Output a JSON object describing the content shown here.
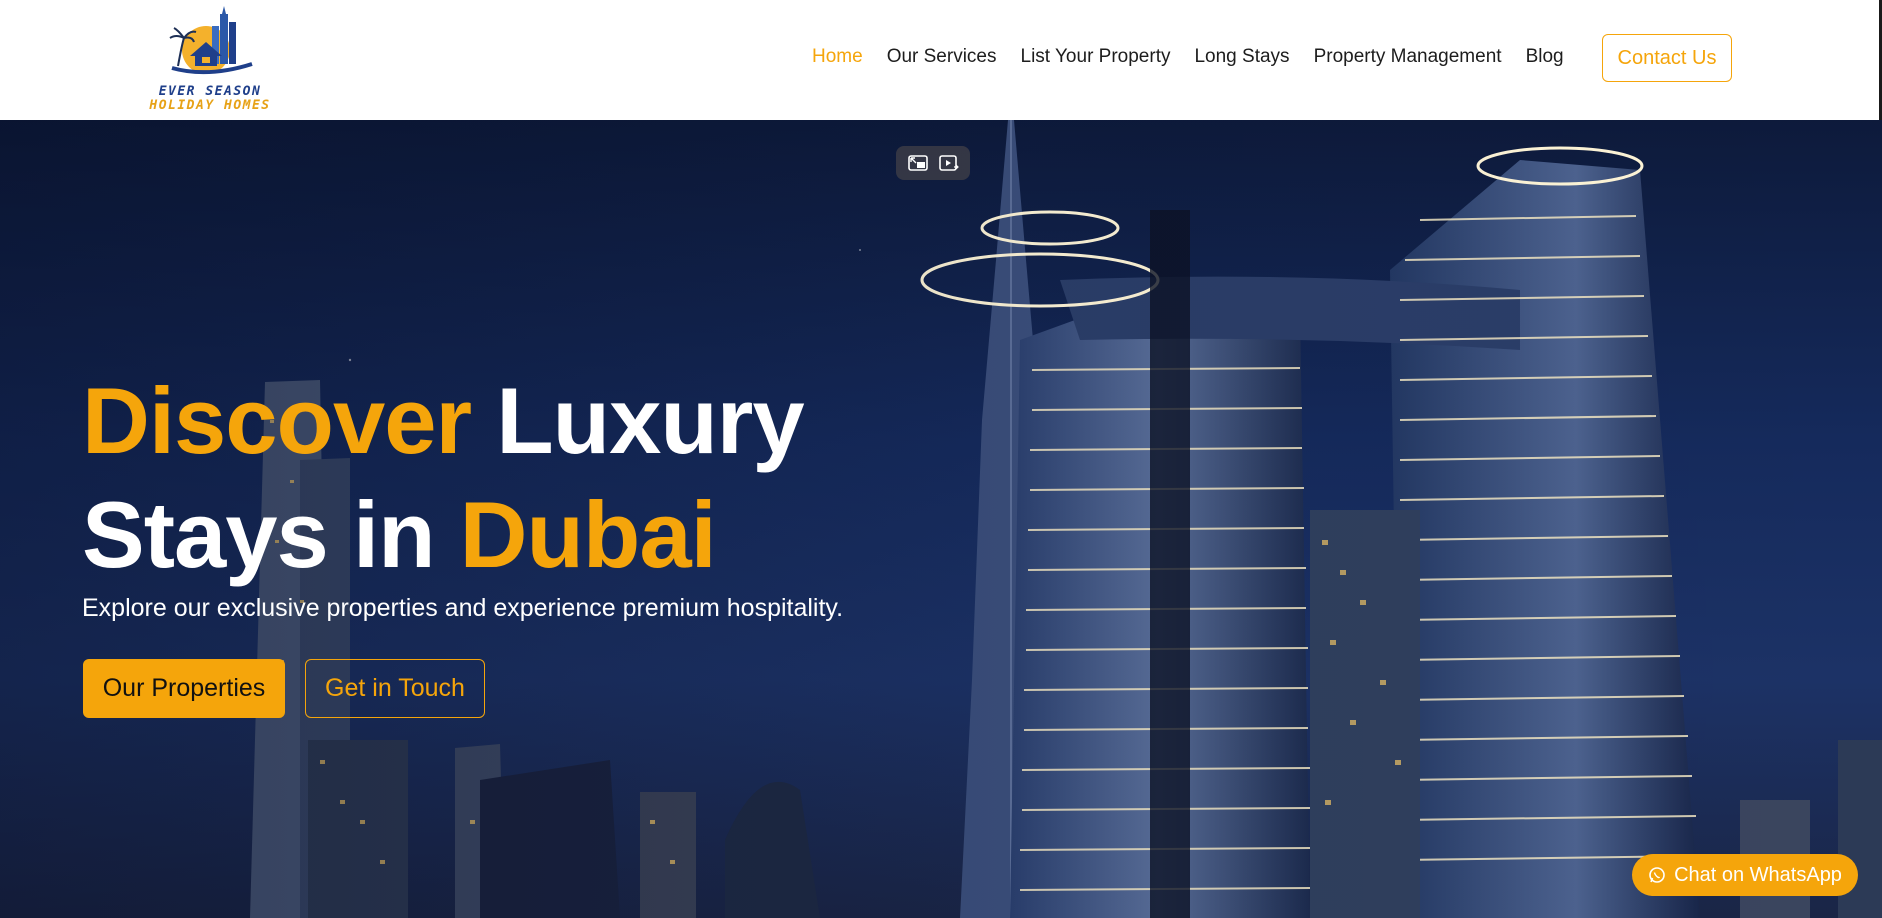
{
  "brand": {
    "line1": "EVER SEASON",
    "line2": "HOLIDAY HOMES",
    "colors": {
      "navy": "#1f3f8a",
      "gold": "#e7a217"
    }
  },
  "nav": {
    "items": [
      {
        "label": "Home",
        "active": true
      },
      {
        "label": "Our Services",
        "active": false
      },
      {
        "label": "List Your Property",
        "active": false
      },
      {
        "label": "Long Stays",
        "active": false
      },
      {
        "label": "Property Management",
        "active": false
      },
      {
        "label": "Blog",
        "active": false
      }
    ],
    "contact_label": "Contact Us"
  },
  "hero": {
    "headline": {
      "word1": "Discover",
      "word2": "Luxury",
      "word3": "Stays in",
      "word4": "Dubai"
    },
    "subtitle": "Explore our exclusive properties and experience premium hospitality.",
    "primary_button": "Our Properties",
    "secondary_button": "Get in Touch",
    "video_controls": [
      "picture-in-picture-icon",
      "video-enhance-icon"
    ]
  },
  "whatsapp": {
    "label": "Chat on WhatsApp",
    "icon": "whatsapp-icon"
  },
  "theme": {
    "accent": "#f5a50b",
    "text_dark": "#1d1d1d",
    "sky": "#152a5c"
  }
}
